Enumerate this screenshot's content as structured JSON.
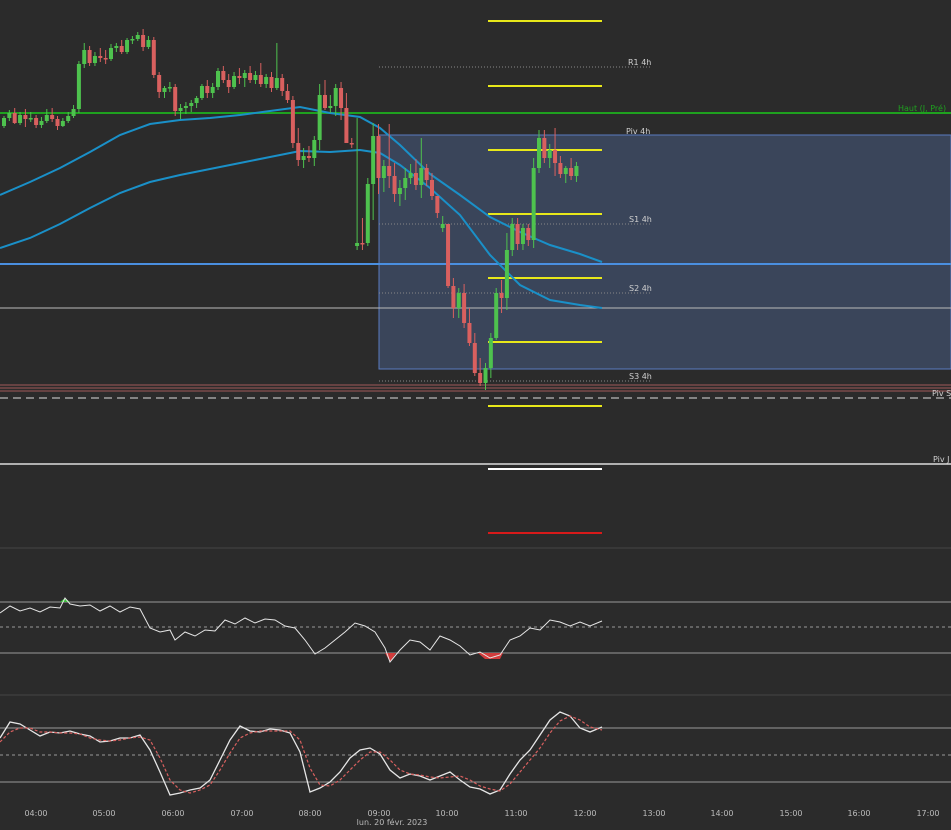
{
  "chart_data": {
    "type": "candlestick",
    "x_axis": {
      "tick_labels": [
        "04:00",
        "05:00",
        "06:00",
        "07:00",
        "08:00",
        "09:00",
        "10:00",
        "11:00",
        "12:00",
        "13:00",
        "14:00",
        "15:00",
        "16:00",
        "17:00"
      ],
      "date_label": "lun. 20 févr. 2023"
    },
    "pivot_labels": {
      "r1": "R1 4h",
      "piv4": "Piv 4h",
      "s1": "S1 4h",
      "s2": "S2 4h",
      "s3": "S3 4h",
      "haut": "Haut (J, Pré)",
      "piv_s": "Piv S",
      "piv_j": "Piv J"
    },
    "candles": [
      {
        "o": "0.0",
        "h": "0.0",
        "l": "0.0",
        "c": "0.0"
      }
    ],
    "candles_compact": "o,h,l,c per bar in price units (≈1 unit per px, inverted)",
    "ohlc": [
      [
        -138,
        -128,
        -140,
        -130
      ],
      [
        -130,
        -122,
        -133,
        -125
      ],
      [
        -125,
        -120,
        -136,
        -135
      ],
      [
        -135,
        -124,
        -137,
        -127
      ],
      [
        -127,
        -121,
        -139,
        -131
      ],
      [
        -131,
        -124,
        -134,
        -130
      ],
      [
        -130,
        -127,
        -140,
        -137
      ],
      [
        -137,
        -129,
        -140,
        -133
      ],
      [
        -133,
        -121,
        -135,
        -127
      ],
      [
        -127,
        -120,
        -134,
        -131
      ],
      [
        -131,
        -128,
        -142,
        -138
      ],
      [
        -138,
        -130,
        -139,
        -133
      ],
      [
        -133,
        -124,
        -135,
        -128
      ],
      [
        -128,
        -117,
        -130,
        -121
      ],
      [
        -121,
        -73,
        -125,
        -76
      ],
      [
        -76,
        -55,
        -80,
        -62
      ],
      [
        -62,
        -58,
        -78,
        -75
      ],
      [
        -75,
        -64,
        -78,
        -68
      ],
      [
        -68,
        -60,
        -74,
        -70
      ],
      [
        -70,
        -62,
        -76,
        -71
      ],
      [
        -71,
        -56,
        -73,
        -60
      ],
      [
        -60,
        -55,
        -64,
        -58
      ],
      [
        -58,
        -52,
        -66,
        -64
      ],
      [
        -64,
        -50,
        -66,
        -52
      ],
      [
        -52,
        -48,
        -56,
        -51
      ],
      [
        -51,
        -44,
        -53,
        -47
      ],
      [
        -47,
        -41,
        -63,
        -59
      ],
      [
        -59,
        -48,
        -61,
        -52
      ],
      [
        -52,
        -49,
        -90,
        -87
      ],
      [
        -87,
        -84,
        -110,
        -104
      ],
      [
        -104,
        -98,
        -110,
        -100
      ],
      [
        -100,
        -94,
        -104,
        -99
      ],
      [
        -99,
        -96,
        -128,
        -123
      ],
      [
        -123,
        -116,
        -131,
        -120
      ],
      [
        -120,
        -114,
        -126,
        -118
      ],
      [
        -118,
        -112,
        -124,
        -115
      ],
      [
        -115,
        -108,
        -120,
        -110
      ],
      [
        -110,
        -96,
        -112,
        -98
      ],
      [
        -98,
        -92,
        -110,
        -105
      ],
      [
        -105,
        -95,
        -110,
        -99
      ],
      [
        -99,
        -80,
        -102,
        -83
      ],
      [
        -83,
        -78,
        -95,
        -92
      ],
      [
        -92,
        -86,
        -105,
        -99
      ],
      [
        -99,
        -84,
        -101,
        -88
      ],
      [
        -88,
        -80,
        -96,
        -90
      ],
      [
        -90,
        -82,
        -99,
        -85
      ],
      [
        -85,
        -78,
        -95,
        -92
      ],
      [
        -92,
        -83,
        -96,
        -87
      ],
      [
        -87,
        -75,
        -99,
        -96
      ],
      [
        -96,
        -86,
        -100,
        -89
      ],
      [
        -89,
        -84,
        -104,
        -100
      ],
      [
        -100,
        -55,
        -102,
        -90
      ],
      [
        -90,
        -86,
        -108,
        -103
      ],
      [
        -103,
        -96,
        -115,
        -112
      ],
      [
        -112,
        -108,
        -160,
        -155
      ],
      [
        -155,
        -140,
        -178,
        -172
      ],
      [
        -172,
        -160,
        -180,
        -168
      ],
      [
        -168,
        -158,
        -174,
        -170
      ],
      [
        -170,
        -148,
        -178,
        -152
      ],
      [
        -152,
        -96,
        -162,
        -107
      ],
      [
        -107,
        -92,
        -122,
        -120
      ],
      [
        -120,
        -107,
        -125,
        -118
      ],
      [
        -118,
        -96,
        -128,
        -100
      ],
      [
        -100,
        -94,
        -132,
        -120
      ],
      [
        -120,
        -105,
        -140,
        -155
      ],
      [
        -155,
        -150,
        -160,
        -155
      ],
      [
        -258,
        -130,
        -262,
        -255
      ],
      [
        -255,
        -230,
        -262,
        -255
      ],
      [
        -255,
        -190,
        -258,
        -196
      ],
      [
        -196,
        -135,
        -232,
        -148
      ],
      [
        -148,
        -136,
        -206,
        -190
      ],
      [
        -190,
        -172,
        -204,
        -178
      ],
      [
        -178,
        -136,
        -200,
        -188
      ],
      [
        -188,
        -175,
        -214,
        -206
      ],
      [
        -206,
        -192,
        -218,
        -200
      ],
      [
        -200,
        -180,
        -212,
        -190
      ],
      [
        -190,
        -176,
        -196,
        -185
      ],
      [
        -185,
        -171,
        -202,
        -197
      ],
      [
        -197,
        -150,
        -210,
        -180
      ],
      [
        -180,
        -176,
        -198,
        -192
      ],
      [
        -192,
        -185,
        -212,
        -208
      ],
      [
        -208,
        -212,
        -230,
        -225
      ],
      [
        -240,
        -228,
        -244,
        -236
      ],
      [
        -236,
        -255,
        -300,
        -298
      ],
      [
        -298,
        -290,
        -330,
        -320
      ],
      [
        -320,
        -300,
        -330,
        -305
      ],
      [
        -305,
        -296,
        -340,
        -335
      ],
      [
        -335,
        -320,
        -358,
        -355
      ],
      [
        -355,
        -345,
        -388,
        -385
      ],
      [
        -385,
        -370,
        -398,
        -395
      ],
      [
        -395,
        -375,
        -402,
        -380
      ],
      [
        -380,
        -345,
        -390,
        -350
      ],
      [
        -350,
        -300,
        -352,
        -305
      ],
      [
        -305,
        -292,
        -325,
        -310
      ],
      [
        -310,
        -245,
        -322,
        -262
      ],
      [
        -262,
        -230,
        -268,
        -236
      ],
      [
        -236,
        -230,
        -262,
        -256
      ],
      [
        -256,
        -236,
        -262,
        -240
      ],
      [
        -240,
        -236,
        -258,
        -252
      ],
      [
        -252,
        -170,
        -260,
        -180
      ],
      [
        -180,
        -142,
        -185,
        -150
      ],
      [
        -150,
        -142,
        -175,
        -170
      ],
      [
        -170,
        -156,
        -180,
        -162
      ],
      [
        -162,
        -140,
        -188,
        -175
      ],
      [
        -175,
        -168,
        -190,
        -186
      ],
      [
        -186,
        -178,
        -195,
        -180
      ],
      [
        -180,
        -170,
        -192,
        -188
      ],
      [
        -188,
        -174,
        -194,
        -178
      ]
    ]
  }
}
